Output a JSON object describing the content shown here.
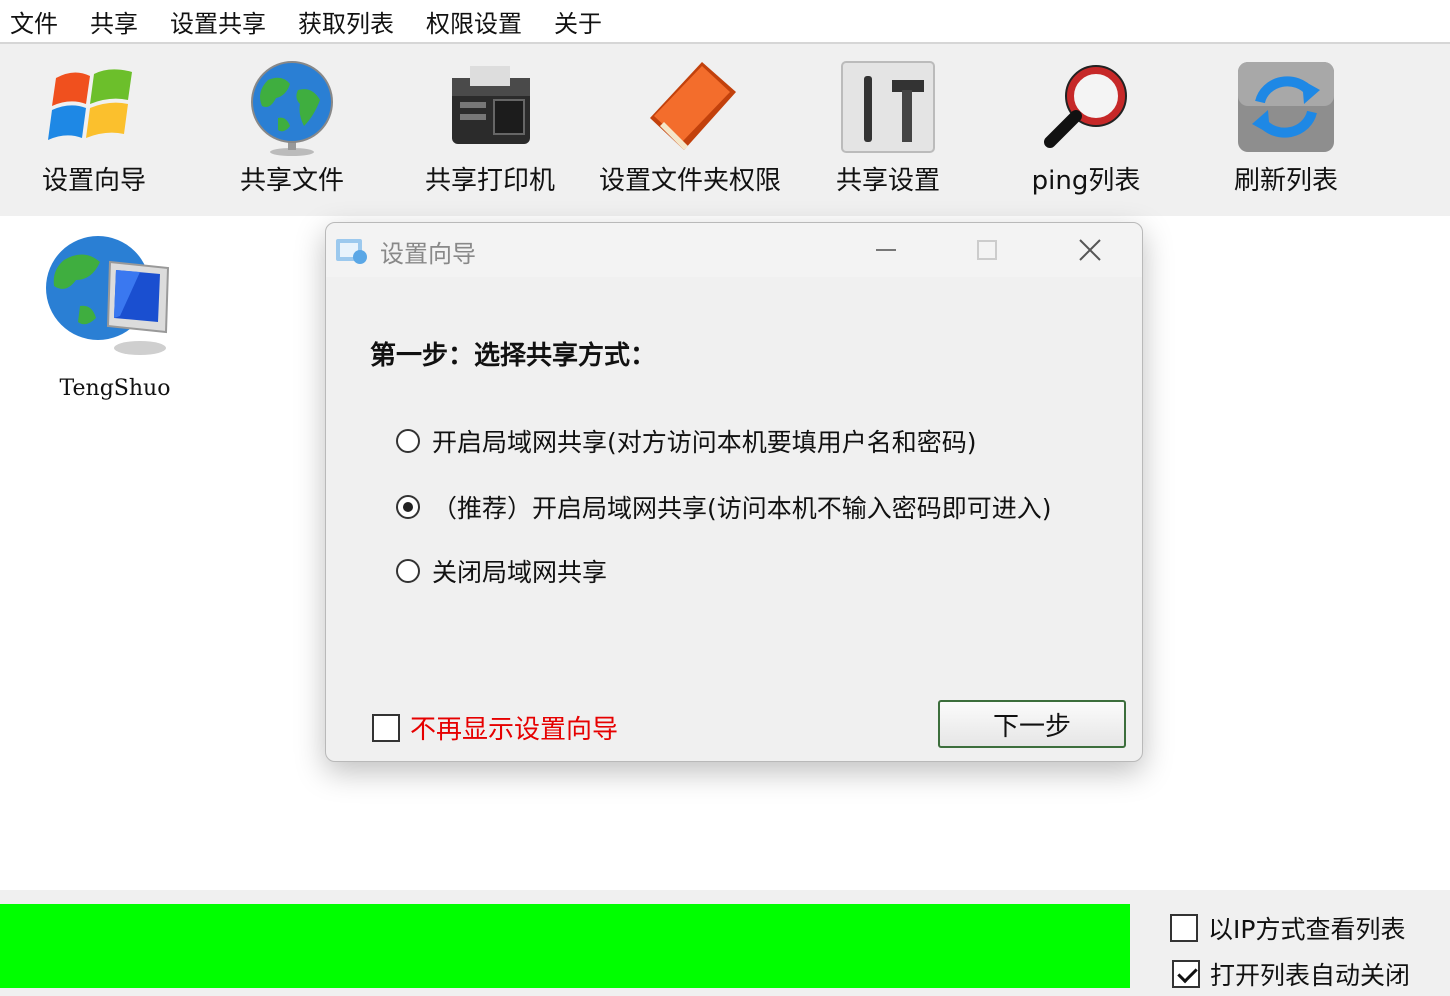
{
  "menu": [
    "文件",
    "共享",
    "设置共享",
    "获取列表",
    "权限设置",
    "关于"
  ],
  "toolbar": [
    {
      "label": "设置向导",
      "icon": "windows-logo-icon"
    },
    {
      "label": "共享文件",
      "icon": "globe-icon"
    },
    {
      "label": "共享打印机",
      "icon": "printer-icon"
    },
    {
      "label": "设置文件夹权限",
      "icon": "notebook-icon"
    },
    {
      "label": "共享设置",
      "icon": "tools-icon"
    },
    {
      "label": "ping列表",
      "icon": "magnifier-icon"
    },
    {
      "label": "刷新列表",
      "icon": "refresh-icon"
    }
  ],
  "computer": {
    "label": "TengShuo",
    "icon": "network-computer-icon"
  },
  "dialog": {
    "title": "设置向导",
    "heading": "第一步：选择共享方式：",
    "options": [
      {
        "label": "开启局域网共享(对方访问本机要填用户名和密码)",
        "selected": false
      },
      {
        "label": "（推荐）开启局域网共享(访问本机不输入密码即可进入)",
        "selected": true
      },
      {
        "label": "关闭局域网共享",
        "selected": false
      }
    ],
    "dont_show": {
      "label": "不再显示设置向导",
      "checked": false,
      "color": "#e60000"
    },
    "next_label": "下一步"
  },
  "status": {
    "progress": 1.0,
    "progress_color": "#00ff00",
    "view_by_ip": {
      "label": "以IP方式查看列表",
      "checked": false
    },
    "auto_close": {
      "label": "打开列表自动关闭",
      "checked": true
    }
  }
}
